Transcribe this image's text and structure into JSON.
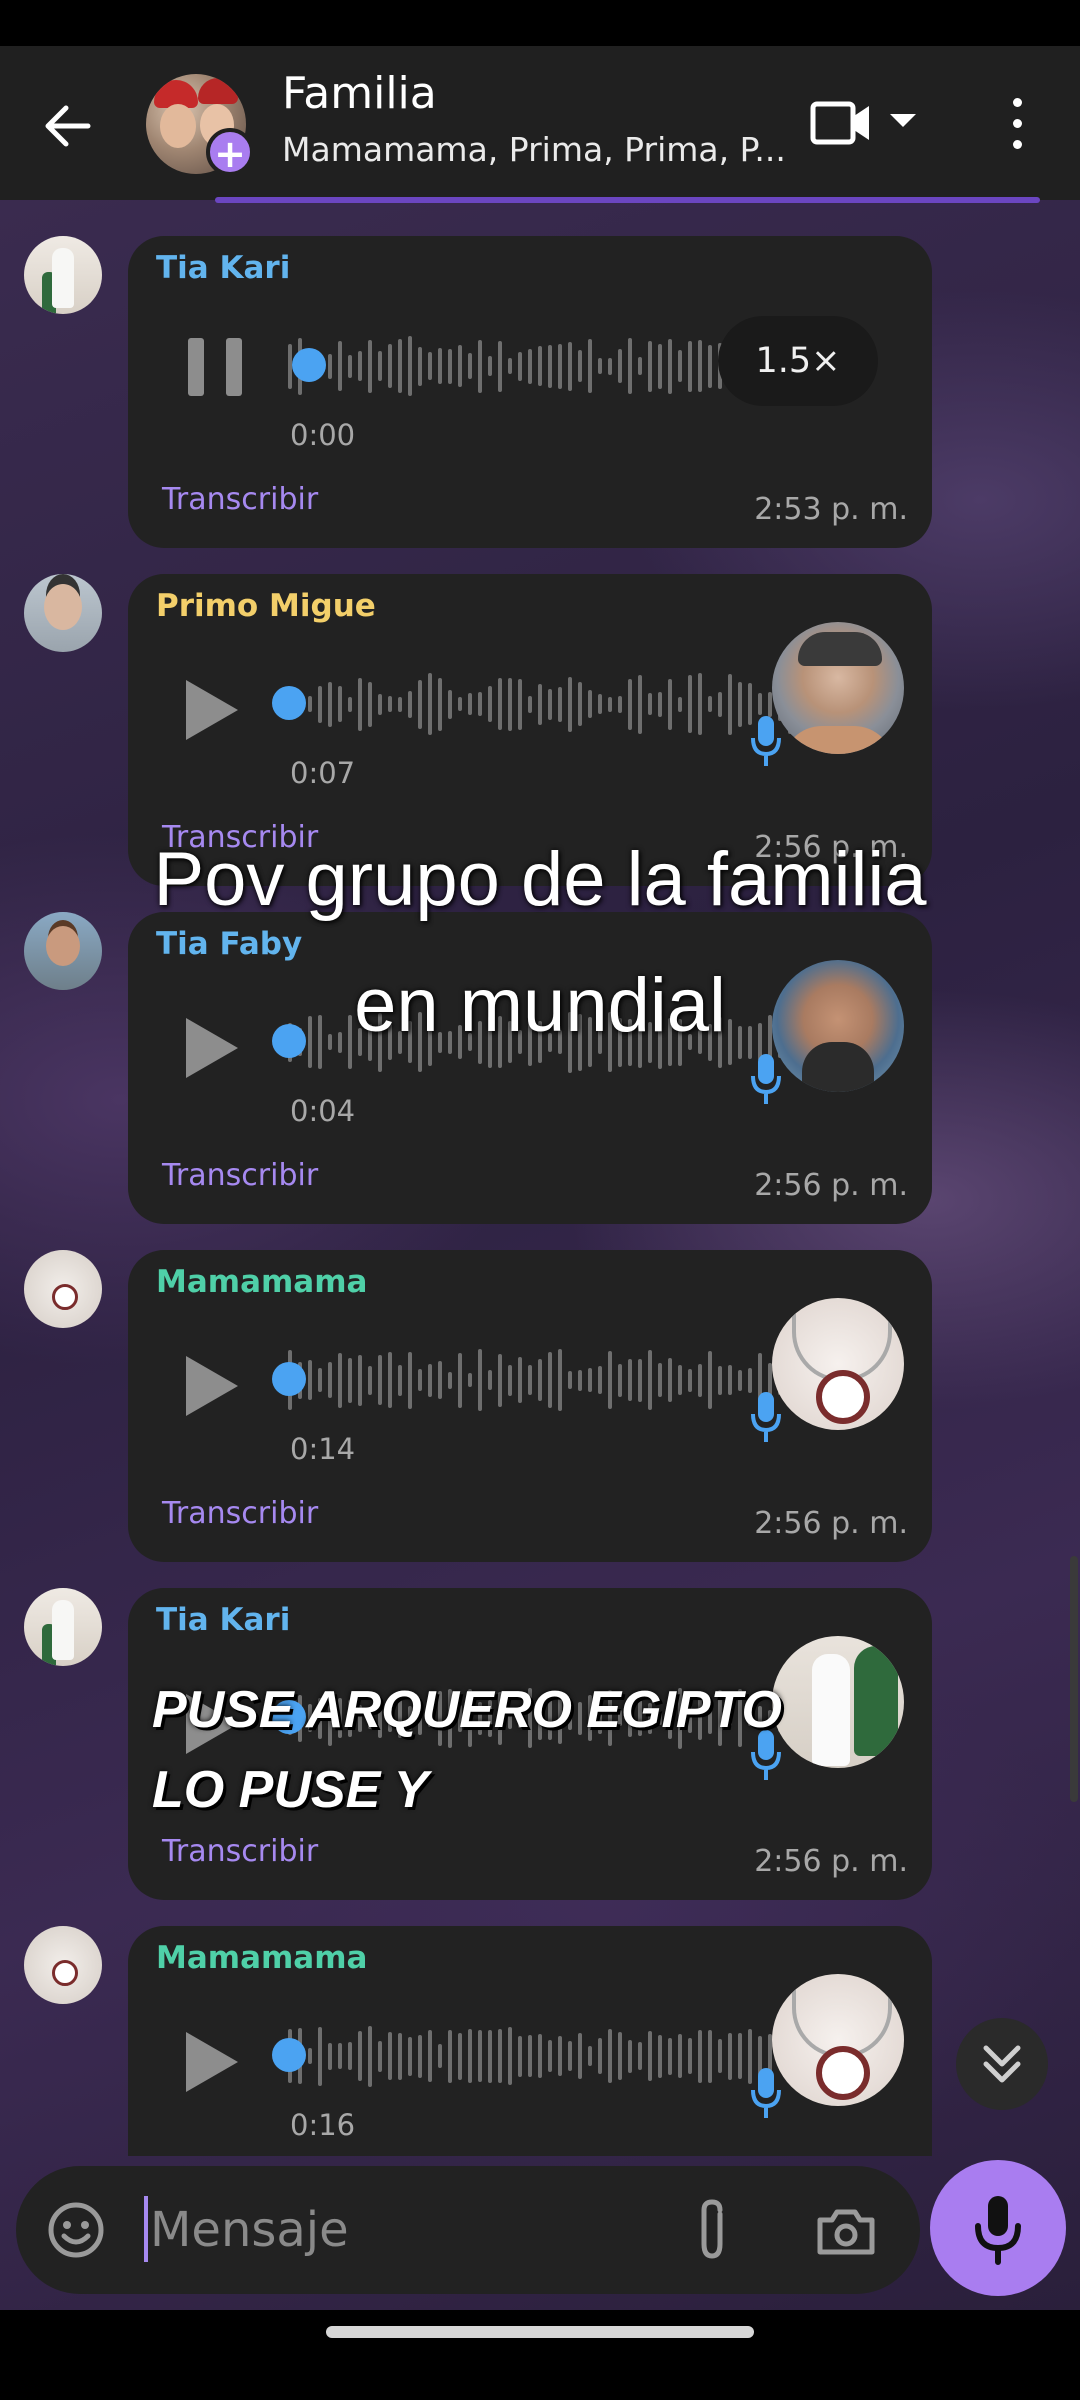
{
  "header": {
    "title": "Familia",
    "members": "Mamamama, Prima, Prima, P..."
  },
  "messages": [
    {
      "sender": "Tia Kari",
      "sender_color": "#62b4ee",
      "duration": "0:00",
      "transcribe": "Transcribir",
      "time": "2:53 p. m.",
      "speed": "1.5×",
      "state": "playing"
    },
    {
      "sender": "Primo Migue",
      "sender_color": "#f3cf6a",
      "duration": "0:07",
      "transcribe": "Transcribir",
      "time": "2:56 p. m.",
      "state": "paused"
    },
    {
      "sender": "Tia Faby",
      "sender_color": "#62b4ee",
      "duration": "0:04",
      "transcribe": "Transcribir",
      "time": "2:56 p. m.",
      "state": "paused"
    },
    {
      "sender": "Mamamama",
      "sender_color": "#4fd0a8",
      "duration": "0:14",
      "transcribe": "Transcribir",
      "time": "2:56 p. m.",
      "state": "paused"
    },
    {
      "sender": "Tia Kari",
      "sender_color": "#62b4ee",
      "duration": "",
      "transcribe": "Transcribir",
      "time": "2:56 p. m.",
      "state": "paused"
    },
    {
      "sender": "Mamamama",
      "sender_color": "#4fd0a8",
      "duration": "0:16",
      "transcribe": "",
      "time": "",
      "state": "paused"
    }
  ],
  "overlay": {
    "line1": "Pov grupo de la familia",
    "line2": "en mundial"
  },
  "caption": {
    "line1": "PUSE ARQUERO EGIPTO",
    "line2": "LO PUSE Y"
  },
  "composer": {
    "placeholder": "Mensaje"
  },
  "icons": [
    "back-arrow-icon",
    "add-member-icon",
    "video-call-icon",
    "dropdown-caret-icon",
    "more-options-icon",
    "play-icon",
    "pause-icon",
    "voice-mic-icon",
    "sticker-icon",
    "attach-icon",
    "camera-icon",
    "mic-icon",
    "scroll-down-icon"
  ],
  "colors": {
    "accent": "#a97df0",
    "header_bg": "#202020",
    "bubble_bg": "#222222",
    "link": "#a689f0",
    "progress_dot": "#4ba3f2"
  }
}
